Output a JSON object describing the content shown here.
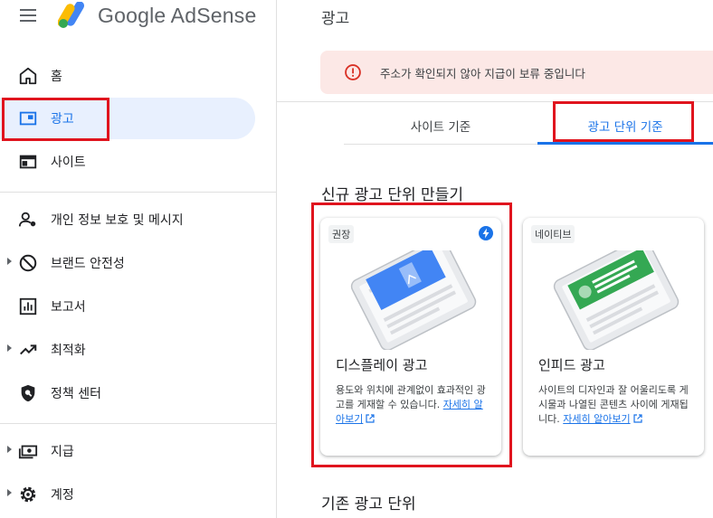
{
  "header": {
    "brand": "Google AdSense",
    "page_title": "광고"
  },
  "sidebar": {
    "items": [
      {
        "label": "홈",
        "icon": "home-icon"
      },
      {
        "label": "광고",
        "icon": "ads-icon"
      },
      {
        "label": "사이트",
        "icon": "sites-icon"
      },
      {
        "label": "개인 정보 보호 및 메시지",
        "icon": "privacy-icon"
      },
      {
        "label": "브랜드 안전성",
        "icon": "block-icon"
      },
      {
        "label": "보고서",
        "icon": "reports-icon"
      },
      {
        "label": "최적화",
        "icon": "trending-icon"
      },
      {
        "label": "정책 센터",
        "icon": "policy-icon"
      },
      {
        "label": "지급",
        "icon": "payments-icon"
      },
      {
        "label": "계정",
        "icon": "settings-icon"
      }
    ]
  },
  "alert": {
    "text": "주소가 확인되지 않아 지급이 보류 중입니다",
    "color": "#fce8e6"
  },
  "tabs": [
    {
      "label": "사이트 기준"
    },
    {
      "label": "광고 단위 기준"
    }
  ],
  "new_section": {
    "title": "신규 광고 단위 만들기"
  },
  "cards": [
    {
      "badge": "권장",
      "title": "디스플레이 광고",
      "desc": "용도와 위치에 관계없이 효과적인 광고를 게재할 수 있습니다.",
      "link": "자세히 알아보기",
      "accent": "#4285f4"
    },
    {
      "badge": "네이티브",
      "title": "인피드 광고",
      "desc": "사이트의 디자인과 잘 어울리도록 게시물과 나열된 콘텐츠 사이에 게재됩니다.",
      "link": "자세히 알아보기",
      "accent": "#34a853"
    }
  ],
  "existing_section": {
    "title": "기존 광고 단위"
  },
  "colors": {
    "active": "#1a73e8",
    "active_bg": "#e8f0fe",
    "highlight": "#e0141e"
  }
}
